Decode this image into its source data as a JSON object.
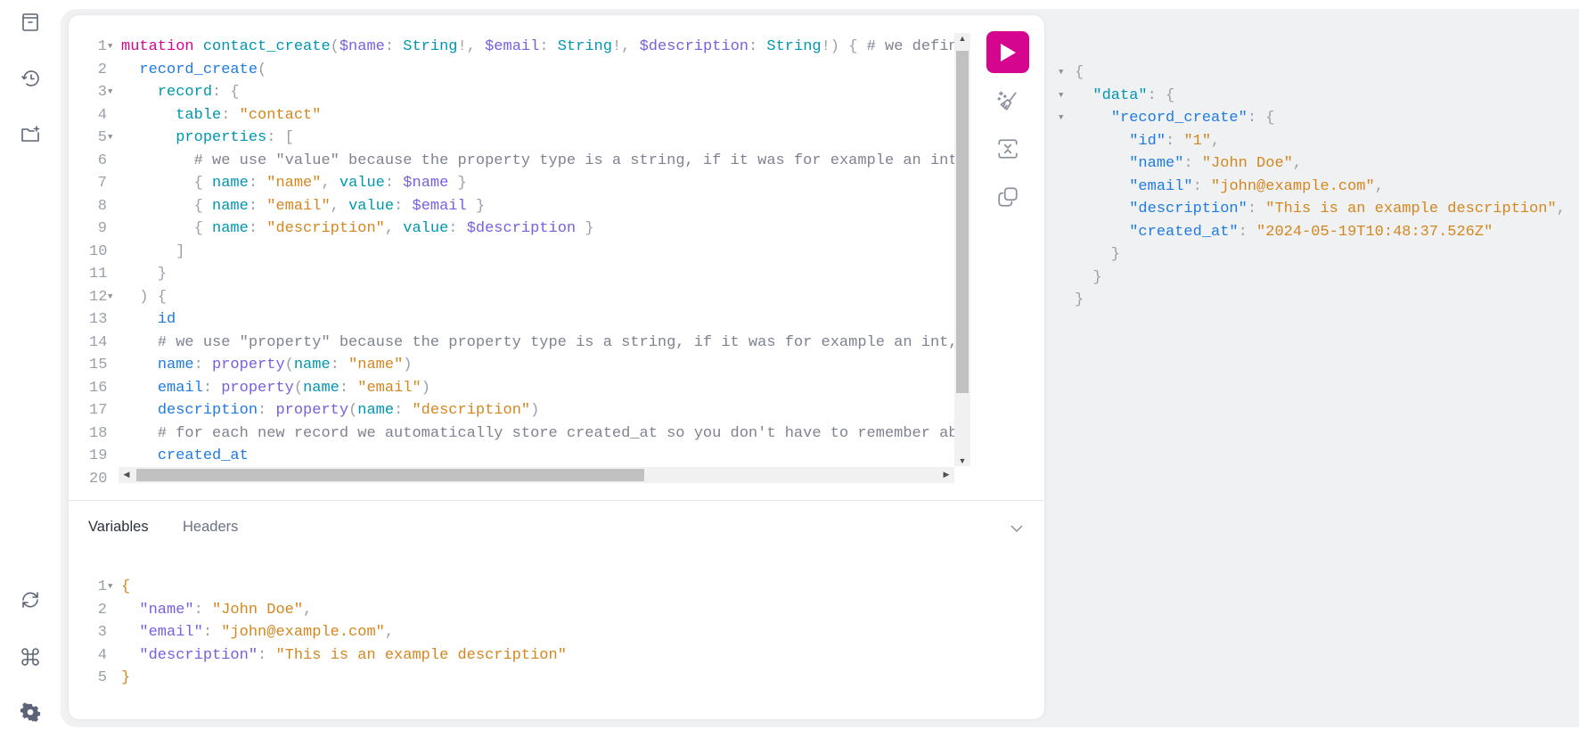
{
  "colors": {
    "accent": "#d60590",
    "background": "#f0f1f3"
  },
  "sidebar": {
    "top_icons": [
      "docs-icon",
      "history-icon",
      "folder-add-icon"
    ],
    "bottom_icons": [
      "refresh-icon",
      "command-icon",
      "settings-icon"
    ]
  },
  "toolbar": {
    "run": "play-icon",
    "prettify": "prettify-icon",
    "merge": "merge-fragments-icon",
    "copy": "copy-icon"
  },
  "editor": {
    "lines": [
      {
        "n": "1",
        "fold": true,
        "t": [
          [
            "kw",
            "mutation"
          ],
          [
            "punc",
            " "
          ],
          [
            "def",
            "contact_create"
          ],
          [
            "punc",
            "("
          ],
          [
            "var",
            "$name"
          ],
          [
            "punc",
            ": "
          ],
          [
            "type",
            "String"
          ],
          [
            "punc",
            "!, "
          ],
          [
            "var",
            "$email"
          ],
          [
            "punc",
            ": "
          ],
          [
            "type",
            "String"
          ],
          [
            "punc",
            "!, "
          ],
          [
            "var",
            "$description"
          ],
          [
            "punc",
            ": "
          ],
          [
            "type",
            "String"
          ],
          [
            "punc",
            "!) { "
          ],
          [
            "cmt",
            "# we defin"
          ]
        ]
      },
      {
        "n": "2",
        "t": [
          [
            "punc",
            "  "
          ],
          [
            "prop",
            "record_create"
          ],
          [
            "punc",
            "("
          ]
        ]
      },
      {
        "n": "3",
        "fold": true,
        "t": [
          [
            "punc",
            "    "
          ],
          [
            "attr",
            "record"
          ],
          [
            "punc",
            ": {"
          ]
        ]
      },
      {
        "n": "4",
        "t": [
          [
            "punc",
            "      "
          ],
          [
            "attr",
            "table"
          ],
          [
            "punc",
            ": "
          ],
          [
            "str",
            "\"contact\""
          ]
        ]
      },
      {
        "n": "5",
        "fold": true,
        "t": [
          [
            "punc",
            "      "
          ],
          [
            "attr",
            "properties"
          ],
          [
            "punc",
            ": ["
          ]
        ]
      },
      {
        "n": "6",
        "t": [
          [
            "punc",
            "        "
          ],
          [
            "cmt",
            "# we use \"value\" because the property type is a string, if it was for example an int"
          ]
        ]
      },
      {
        "n": "7",
        "t": [
          [
            "punc",
            "        { "
          ],
          [
            "attr",
            "name"
          ],
          [
            "punc",
            ": "
          ],
          [
            "str",
            "\"name\""
          ],
          [
            "punc",
            ", "
          ],
          [
            "attr",
            "value"
          ],
          [
            "punc",
            ": "
          ],
          [
            "var",
            "$name"
          ],
          [
            "punc",
            " }"
          ]
        ]
      },
      {
        "n": "8",
        "t": [
          [
            "punc",
            "        { "
          ],
          [
            "attr",
            "name"
          ],
          [
            "punc",
            ": "
          ],
          [
            "str",
            "\"email\""
          ],
          [
            "punc",
            ", "
          ],
          [
            "attr",
            "value"
          ],
          [
            "punc",
            ": "
          ],
          [
            "var",
            "$email"
          ],
          [
            "punc",
            " }"
          ]
        ]
      },
      {
        "n": "9",
        "t": [
          [
            "punc",
            "        { "
          ],
          [
            "attr",
            "name"
          ],
          [
            "punc",
            ": "
          ],
          [
            "str",
            "\"description\""
          ],
          [
            "punc",
            ", "
          ],
          [
            "attr",
            "value"
          ],
          [
            "punc",
            ": "
          ],
          [
            "var",
            "$description"
          ],
          [
            "punc",
            " }"
          ]
        ]
      },
      {
        "n": "10",
        "t": [
          [
            "punc",
            "      ]"
          ]
        ]
      },
      {
        "n": "11",
        "t": [
          [
            "punc",
            "    }"
          ]
        ]
      },
      {
        "n": "12",
        "fold": true,
        "t": [
          [
            "punc",
            "  ) {"
          ]
        ]
      },
      {
        "n": "13",
        "t": [
          [
            "punc",
            "    "
          ],
          [
            "prop",
            "id"
          ]
        ]
      },
      {
        "n": "14",
        "t": [
          [
            "punc",
            "    "
          ],
          [
            "cmt",
            "# we use \"property\" because the property type is a string, if it was for example an int,"
          ]
        ]
      },
      {
        "n": "15",
        "t": [
          [
            "punc",
            "    "
          ],
          [
            "prop",
            "name"
          ],
          [
            "punc",
            ": "
          ],
          [
            "fn",
            "property"
          ],
          [
            "punc",
            "("
          ],
          [
            "attr",
            "name"
          ],
          [
            "punc",
            ": "
          ],
          [
            "str",
            "\"name\""
          ],
          [
            "punc",
            ")"
          ]
        ]
      },
      {
        "n": "16",
        "t": [
          [
            "punc",
            "    "
          ],
          [
            "prop",
            "email"
          ],
          [
            "punc",
            ": "
          ],
          [
            "fn",
            "property"
          ],
          [
            "punc",
            "("
          ],
          [
            "attr",
            "name"
          ],
          [
            "punc",
            ": "
          ],
          [
            "str",
            "\"email\""
          ],
          [
            "punc",
            ")"
          ]
        ]
      },
      {
        "n": "17",
        "t": [
          [
            "punc",
            "    "
          ],
          [
            "prop",
            "description"
          ],
          [
            "punc",
            ": "
          ],
          [
            "fn",
            "property"
          ],
          [
            "punc",
            "("
          ],
          [
            "attr",
            "name"
          ],
          [
            "punc",
            ": "
          ],
          [
            "str",
            "\"description\""
          ],
          [
            "punc",
            ")"
          ]
        ]
      },
      {
        "n": "18",
        "t": [
          [
            "punc",
            "    "
          ],
          [
            "cmt",
            "# for each new record we automatically store created_at so you don't have to remember abo"
          ]
        ]
      },
      {
        "n": "19",
        "t": [
          [
            "punc",
            "    "
          ],
          [
            "prop",
            "created_at"
          ]
        ]
      },
      {
        "n": "20",
        "t": []
      }
    ]
  },
  "tabs": {
    "variables": "Variables",
    "headers": "Headers",
    "toggle": "chevron-down-icon"
  },
  "variables": {
    "lines": [
      {
        "n": "1",
        "fold": true,
        "t": [
          [
            "brace",
            "{"
          ]
        ]
      },
      {
        "n": "2",
        "t": [
          [
            "punc",
            "  "
          ],
          [
            "key",
            "\"name\""
          ],
          [
            "punc",
            ": "
          ],
          [
            "str",
            "\"John Doe\""
          ],
          [
            "punc",
            ","
          ]
        ]
      },
      {
        "n": "3",
        "t": [
          [
            "punc",
            "  "
          ],
          [
            "key",
            "\"email\""
          ],
          [
            "punc",
            ": "
          ],
          [
            "str",
            "\"john@example.com\""
          ],
          [
            "punc",
            ","
          ]
        ]
      },
      {
        "n": "4",
        "t": [
          [
            "punc",
            "  "
          ],
          [
            "key",
            "\"description\""
          ],
          [
            "punc",
            ": "
          ],
          [
            "str",
            "\"This is an example description\""
          ]
        ]
      },
      {
        "n": "5",
        "t": [
          [
            "brace",
            "}"
          ]
        ]
      }
    ]
  },
  "response": {
    "lines": [
      {
        "fold": true,
        "t": [
          [
            "punc",
            "{"
          ]
        ]
      },
      {
        "fold": true,
        "t": [
          [
            "punc",
            "  "
          ],
          [
            "attr",
            "\"data\""
          ],
          [
            "punc",
            ": {"
          ]
        ]
      },
      {
        "fold": true,
        "t": [
          [
            "punc",
            "    "
          ],
          [
            "prop",
            "\"record_create\""
          ],
          [
            "punc",
            ": {"
          ]
        ]
      },
      {
        "t": [
          [
            "punc",
            "      "
          ],
          [
            "prop",
            "\"id\""
          ],
          [
            "punc",
            ": "
          ],
          [
            "str",
            "\"1\""
          ],
          [
            "punc",
            ","
          ]
        ]
      },
      {
        "t": [
          [
            "punc",
            "      "
          ],
          [
            "prop",
            "\"name\""
          ],
          [
            "punc",
            ": "
          ],
          [
            "str",
            "\"John Doe\""
          ],
          [
            "punc",
            ","
          ]
        ]
      },
      {
        "t": [
          [
            "punc",
            "      "
          ],
          [
            "prop",
            "\"email\""
          ],
          [
            "punc",
            ": "
          ],
          [
            "str",
            "\"john@example.com\""
          ],
          [
            "punc",
            ","
          ]
        ]
      },
      {
        "t": [
          [
            "punc",
            "      "
          ],
          [
            "prop",
            "\"description\""
          ],
          [
            "punc",
            ": "
          ],
          [
            "str",
            "\"This is an example description\""
          ],
          [
            "punc",
            ","
          ]
        ]
      },
      {
        "t": [
          [
            "punc",
            "      "
          ],
          [
            "prop",
            "\"created_at\""
          ],
          [
            "punc",
            ": "
          ],
          [
            "str",
            "\"2024-05-19T10:48:37.526Z\""
          ]
        ]
      },
      {
        "t": [
          [
            "punc",
            "    }"
          ]
        ]
      },
      {
        "t": [
          [
            "punc",
            "  }"
          ]
        ]
      },
      {
        "t": [
          [
            "punc",
            "}"
          ]
        ]
      }
    ]
  }
}
